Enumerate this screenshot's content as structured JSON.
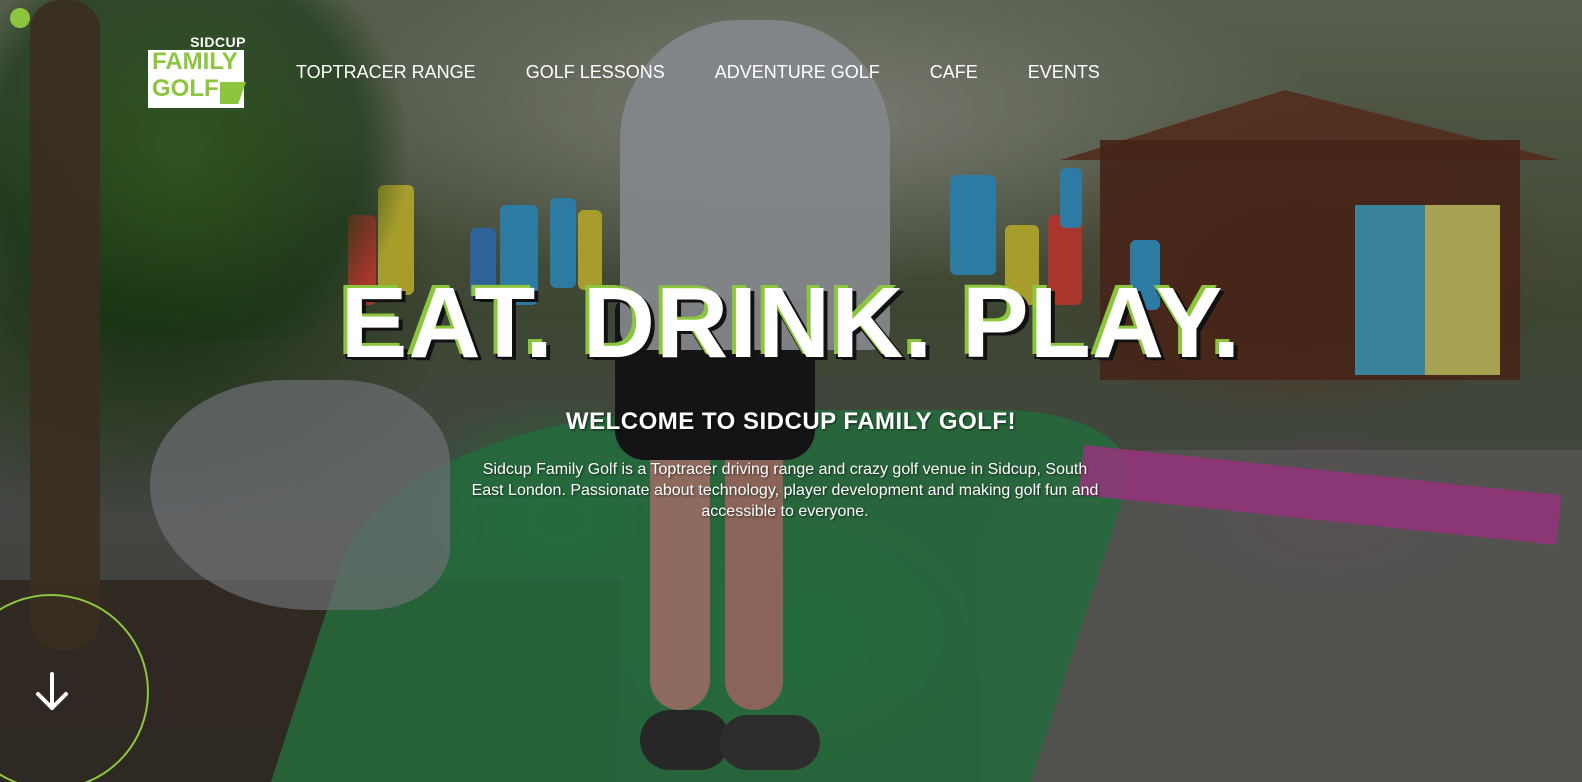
{
  "header": {
    "logo": {
      "line1": "SIDCUP",
      "line2": "FAMILY",
      "line3": "GOLF"
    },
    "nav": [
      {
        "label": "TOPTRACER RANGE",
        "name": "nav-toptracer-range"
      },
      {
        "label": "GOLF LESSONS",
        "name": "nav-golf-lessons"
      },
      {
        "label": "ADVENTURE GOLF",
        "name": "nav-adventure-golf"
      },
      {
        "label": "CAFE",
        "name": "nav-cafe"
      },
      {
        "label": "EVENTS",
        "name": "nav-events"
      }
    ]
  },
  "hero": {
    "headline": "EAT. DRINK. PLAY.",
    "welcome": "WELCOME TO SIDCUP FAMILY GOLF!",
    "intro": "Sidcup Family Golf is a Toptracer driving range and crazy golf venue in Sidcup, South East London. Passionate about technology, player development and making golf fun and accessible to everyone."
  },
  "scroll": {
    "icon": "arrow-down-icon"
  },
  "colors": {
    "brand_green": "#8cc63f",
    "text_white": "#ffffff"
  }
}
